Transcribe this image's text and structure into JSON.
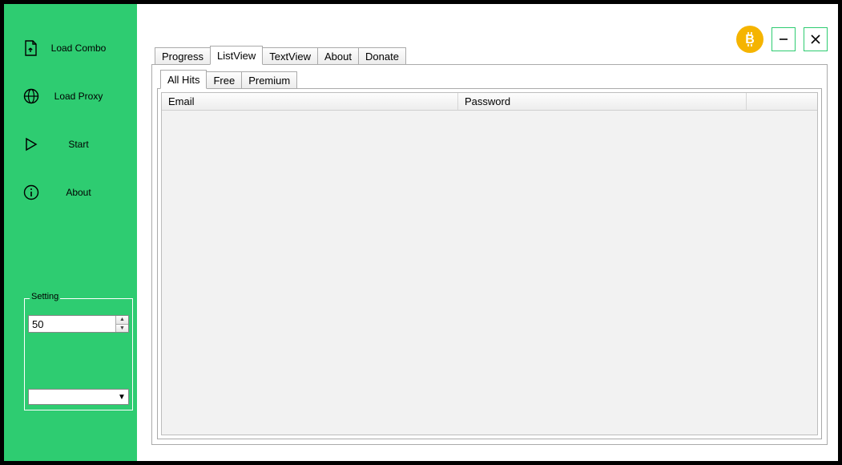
{
  "sidebar": {
    "items": [
      {
        "label": "Load Combo"
      },
      {
        "label": "Load Proxy"
      },
      {
        "label": "Start"
      },
      {
        "label": "About"
      }
    ],
    "setting": {
      "legend": "Setting",
      "spinner_value": "50",
      "combo_value": ""
    }
  },
  "main": {
    "tabs": [
      {
        "label": "Progress"
      },
      {
        "label": "ListView"
      },
      {
        "label": "TextView"
      },
      {
        "label": "About"
      },
      {
        "label": "Donate"
      }
    ],
    "subtabs": [
      {
        "label": "All Hits"
      },
      {
        "label": "Free"
      },
      {
        "label": "Premium"
      }
    ],
    "columns": {
      "email": "Email",
      "password": "Password"
    }
  }
}
